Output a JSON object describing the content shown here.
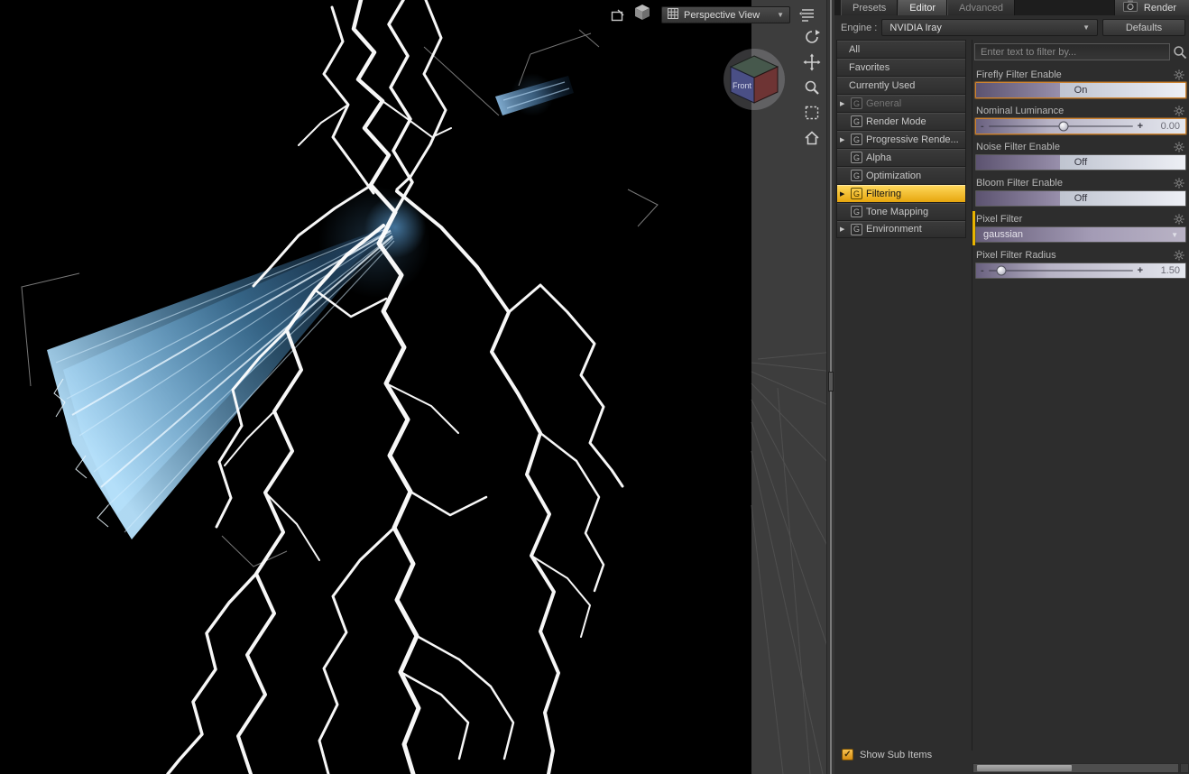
{
  "viewport": {
    "view_selector": {
      "label": "Perspective View"
    },
    "orientation_cube": {
      "front_label": "Front"
    }
  },
  "render_panel": {
    "tabs": [
      {
        "label": "Presets",
        "active": false,
        "dim": false
      },
      {
        "label": "Editor",
        "active": true,
        "dim": false
      },
      {
        "label": "Advanced",
        "active": false,
        "dim": true
      }
    ],
    "render_button_label": "Render",
    "engine": {
      "label": "Engine :",
      "value": "NVIDIA Iray"
    },
    "defaults_button_label": "Defaults",
    "categories": [
      {
        "label": "All",
        "icon": "",
        "expander": false,
        "selected": false,
        "disabled": false
      },
      {
        "label": "Favorites",
        "icon": "",
        "expander": false,
        "selected": false,
        "disabled": false
      },
      {
        "label": "Currently Used",
        "icon": "",
        "expander": false,
        "selected": false,
        "disabled": false
      },
      {
        "label": "General",
        "icon": "G",
        "expander": true,
        "selected": false,
        "disabled": true
      },
      {
        "label": "Render Mode",
        "icon": "G",
        "expander": false,
        "selected": false,
        "disabled": false
      },
      {
        "label": "Progressive Rende...",
        "icon": "G",
        "expander": true,
        "selected": false,
        "disabled": false
      },
      {
        "label": "Alpha",
        "icon": "G",
        "expander": false,
        "selected": false,
        "disabled": false
      },
      {
        "label": "Optimization",
        "icon": "G",
        "expander": false,
        "selected": false,
        "disabled": false
      },
      {
        "label": "Filtering",
        "icon": "G",
        "expander": true,
        "selected": true,
        "disabled": false
      },
      {
        "label": "Tone Mapping",
        "icon": "G",
        "expander": false,
        "selected": false,
        "disabled": false
      },
      {
        "label": "Environment",
        "icon": "G",
        "expander": true,
        "selected": false,
        "disabled": false
      }
    ],
    "search": {
      "placeholder": "Enter text to filter by..."
    },
    "properties": [
      {
        "name": "Firefly Filter Enable",
        "type": "toggle",
        "value": "On",
        "changed": true,
        "flagged": false
      },
      {
        "name": "Nominal Luminance",
        "type": "slider",
        "value": "0.00",
        "changed": true,
        "flagged": false,
        "knob": 0.52
      },
      {
        "name": "Noise Filter Enable",
        "type": "toggle",
        "value": "Off",
        "changed": false,
        "flagged": false
      },
      {
        "name": "Bloom Filter Enable",
        "type": "toggle",
        "value": "Off",
        "changed": false,
        "flagged": false
      },
      {
        "name": "Pixel Filter",
        "type": "dropdown",
        "value": "gaussian",
        "changed": false,
        "flagged": true
      },
      {
        "name": "Pixel Filter Radius",
        "type": "slider",
        "value": "1.50",
        "changed": false,
        "flagged": false,
        "knob": 0.09
      }
    ],
    "show_sub_items_label": "Show Sub Items",
    "accent_colors": {
      "selected_category": "#e7a60e",
      "changed_highlight": "#cf8430"
    }
  }
}
